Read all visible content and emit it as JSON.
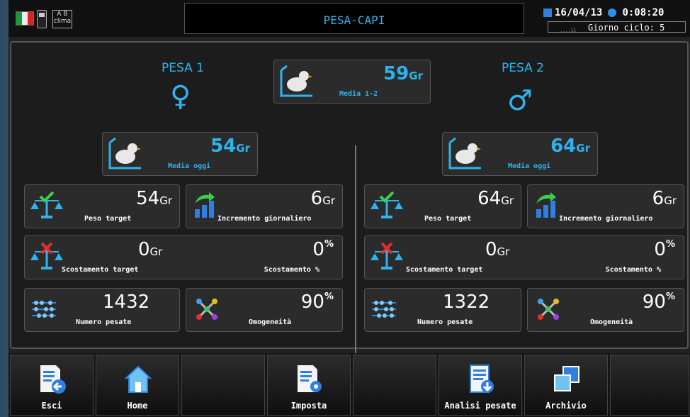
{
  "header": {
    "title": "PESA-CAPI",
    "date": "16/04/13",
    "time": "0:08:20",
    "cycle": "Giorno ciclo: 5",
    "clima": "clima"
  },
  "left": {
    "title": "PESA 1",
    "symbol": "♀",
    "media": {
      "value": "54",
      "unit": "Gr",
      "label": "Media oggi"
    },
    "peso_target": {
      "value": "54",
      "unit": "Gr",
      "label": "Peso target"
    },
    "incremento": {
      "value": "6",
      "unit": "Gr",
      "label": "Incremento giornaliero"
    },
    "scostamento": {
      "value": "0",
      "unit": "Gr",
      "label": "Scostamento target"
    },
    "scostamento_pct": {
      "value": "0",
      "unit": "%",
      "label": "Scostamento %"
    },
    "numero": {
      "value": "1432",
      "label": "Numero pesate"
    },
    "omogeneita": {
      "value": "90",
      "unit": "%",
      "label": "Omogeneità"
    }
  },
  "right": {
    "title": "PESA 2",
    "symbol": "♂",
    "media": {
      "value": "64",
      "unit": "Gr",
      "label": "Media oggi"
    },
    "peso_target": {
      "value": "64",
      "unit": "Gr",
      "label": "Peso target"
    },
    "incremento": {
      "value": "6",
      "unit": "Gr",
      "label": "Incremento giornaliero"
    },
    "scostamento": {
      "value": "0",
      "unit": "Gr",
      "label": "Scostamento target"
    },
    "scostamento_pct": {
      "value": "0",
      "unit": "%",
      "label": "Scostamento %"
    },
    "numero": {
      "value": "1322",
      "label": "Numero pesate"
    },
    "omogeneita": {
      "value": "90",
      "unit": "%",
      "label": "Omogeneità"
    }
  },
  "center": {
    "value": "59",
    "unit": "Gr",
    "label": "Media 1-2"
  },
  "footer": {
    "esci": "Esci",
    "home": "Home",
    "imposta": "Imposta",
    "analisi": "Analisi pesate",
    "archivio": "Archivio"
  },
  "colors": {
    "accent": "#2fb3ec",
    "background": "#1c1c1c",
    "card": "#2b2b2b"
  }
}
